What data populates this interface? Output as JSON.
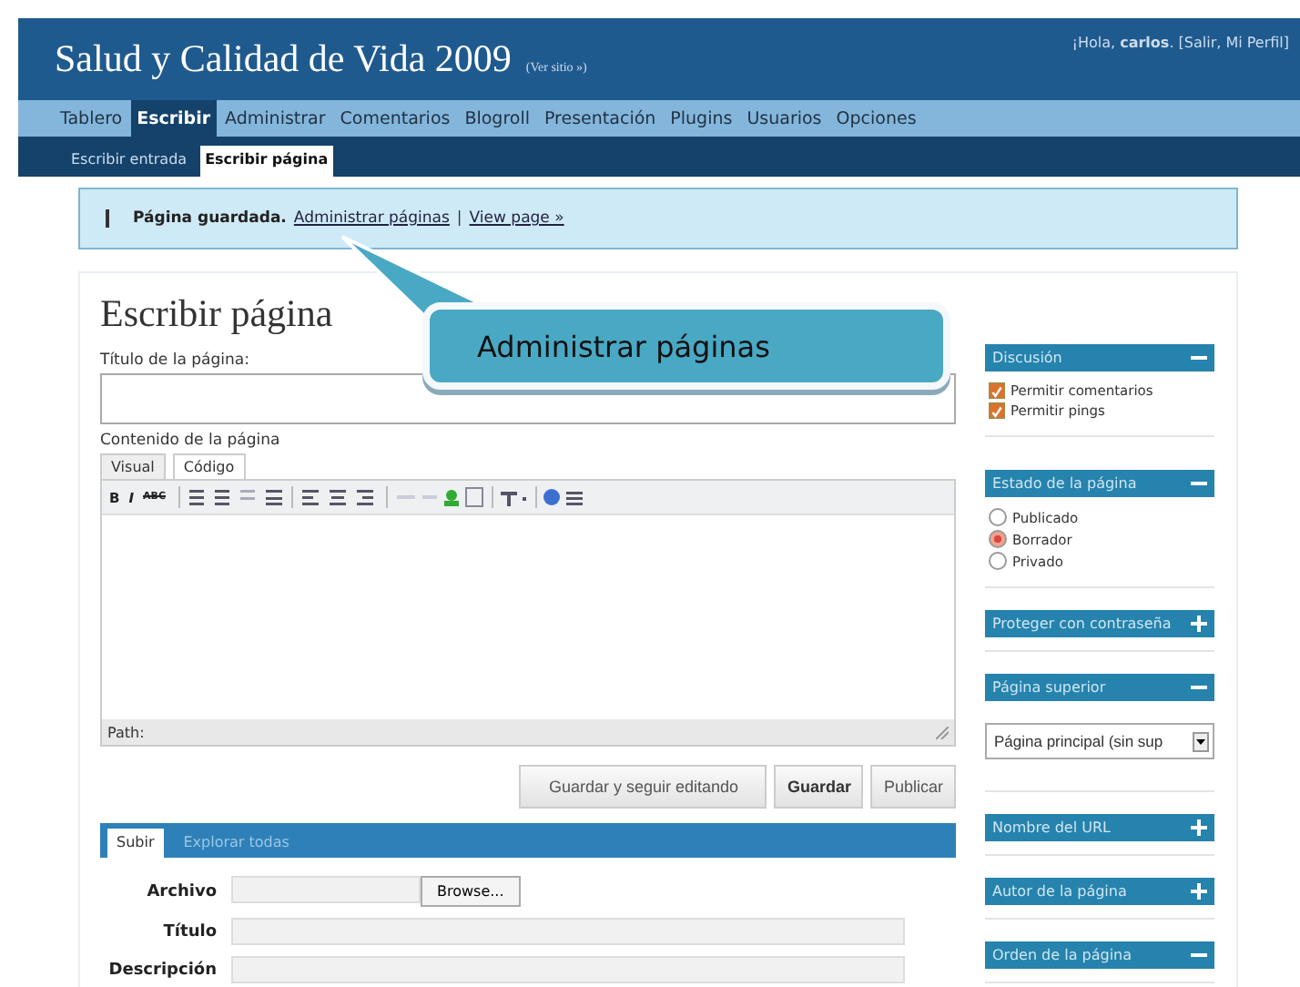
{
  "header": {
    "title": "Salud y Calidad de Vida 2009",
    "site_link": "(Ver sitio »)",
    "greeting": "¡Hola, **carlos**. [Salir, Mi Perfil]"
  },
  "nav": [
    {
      "label": "Tablero",
      "selected": false
    },
    {
      "label": "Escribir",
      "selected": true
    },
    {
      "label": "Administrar",
      "selected": false
    },
    {
      "label": "Comentarios",
      "selected": false
    },
    {
      "label": "Blogroll",
      "selected": false
    },
    {
      "label": "Presentación",
      "selected": false
    },
    {
      "label": "Plugins",
      "selected": false
    },
    {
      "label": "Usuarios",
      "selected": false
    },
    {
      "label": "Opciones",
      "selected": false
    }
  ],
  "subnav": [
    {
      "label": "Escribir entrada",
      "selected": false
    },
    {
      "label": "Escribir página",
      "selected": true
    }
  ],
  "notice": {
    "message": "Página guardada.",
    "links": [
      "Administrar páginas",
      "View page »"
    ],
    "separator": "|"
  },
  "callout": {
    "text": "Administrar páginas"
  },
  "heading": "Escribir página",
  "title_field": {
    "label": "Título de la página:"
  },
  "content_label": "Contenido de la página",
  "editor_tabs": [
    {
      "label": "Visual",
      "selected": false
    },
    {
      "label": "Código",
      "selected": true
    }
  ],
  "toolbar_text": [
    "B",
    "I",
    "ABC"
  ],
  "path_label": "Path:",
  "buttons": [
    {
      "label": "Guardar y seguir editando",
      "kind": "normal"
    },
    {
      "label": "Guardar",
      "kind": "strong"
    },
    {
      "label": "Publicar",
      "kind": "normal"
    }
  ],
  "upload": {
    "tabs": [
      {
        "label": "Subir",
        "selected": true
      },
      {
        "label": "Explorar todas",
        "selected": false
      }
    ],
    "fields": [
      {
        "label": "Archivo",
        "kind": "file",
        "button": "Browse..."
      },
      {
        "label": "Título",
        "kind": "text"
      },
      {
        "label": "Descripción",
        "kind": "text"
      }
    ]
  },
  "sidebar": [
    {
      "title": "Discusión",
      "expanded": true,
      "kind": "checkboxes",
      "items": [
        {
          "label": "Permitir comentarios",
          "checked": true
        },
        {
          "label": "Permitir pings",
          "checked": true
        }
      ]
    },
    {
      "title": "Estado de la página",
      "expanded": true,
      "kind": "radios",
      "items": [
        {
          "label": "Publicado",
          "selected": false
        },
        {
          "label": "Borrador",
          "selected": true
        },
        {
          "label": "Privado",
          "selected": false
        }
      ]
    },
    {
      "title": "Proteger con contraseña",
      "expanded": false
    },
    {
      "title": "Página superior",
      "expanded": true,
      "kind": "select",
      "value": "Página principal (sin sup"
    },
    {
      "title": "Nombre del URL",
      "expanded": false
    },
    {
      "title": "Autor de la página",
      "expanded": false
    },
    {
      "title": "Orden de la página",
      "expanded": true
    }
  ]
}
